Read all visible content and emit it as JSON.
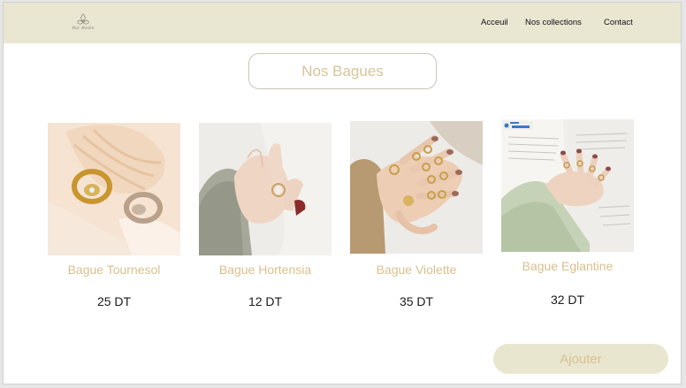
{
  "nav": {
    "links": [
      "Acceuil",
      "Nos collections",
      "Contact"
    ]
  },
  "logo": {
    "name": "Bar Bedin",
    "icon": "flower-logo-icon"
  },
  "page": {
    "title": "Nos Bagues",
    "add_button": "Ajouter"
  },
  "products": [
    {
      "name": "Bague Tournesol",
      "price": "25 DT",
      "image_icon": "rings-on-shell-image"
    },
    {
      "name": "Bague Hortensia",
      "price": "12 DT",
      "image_icon": "hand-with-ring-image"
    },
    {
      "name": "Bague Violette",
      "price": "35 DT",
      "image_icon": "hand-with-many-rings-image"
    },
    {
      "name": "Bague Eglantine",
      "price": "32 DT",
      "image_icon": "hand-on-book-image"
    }
  ],
  "colors": {
    "navbar_bg": "#e9e6d2",
    "accent_gold": "#d8c08e",
    "button_bg": "#e9e6d0"
  }
}
